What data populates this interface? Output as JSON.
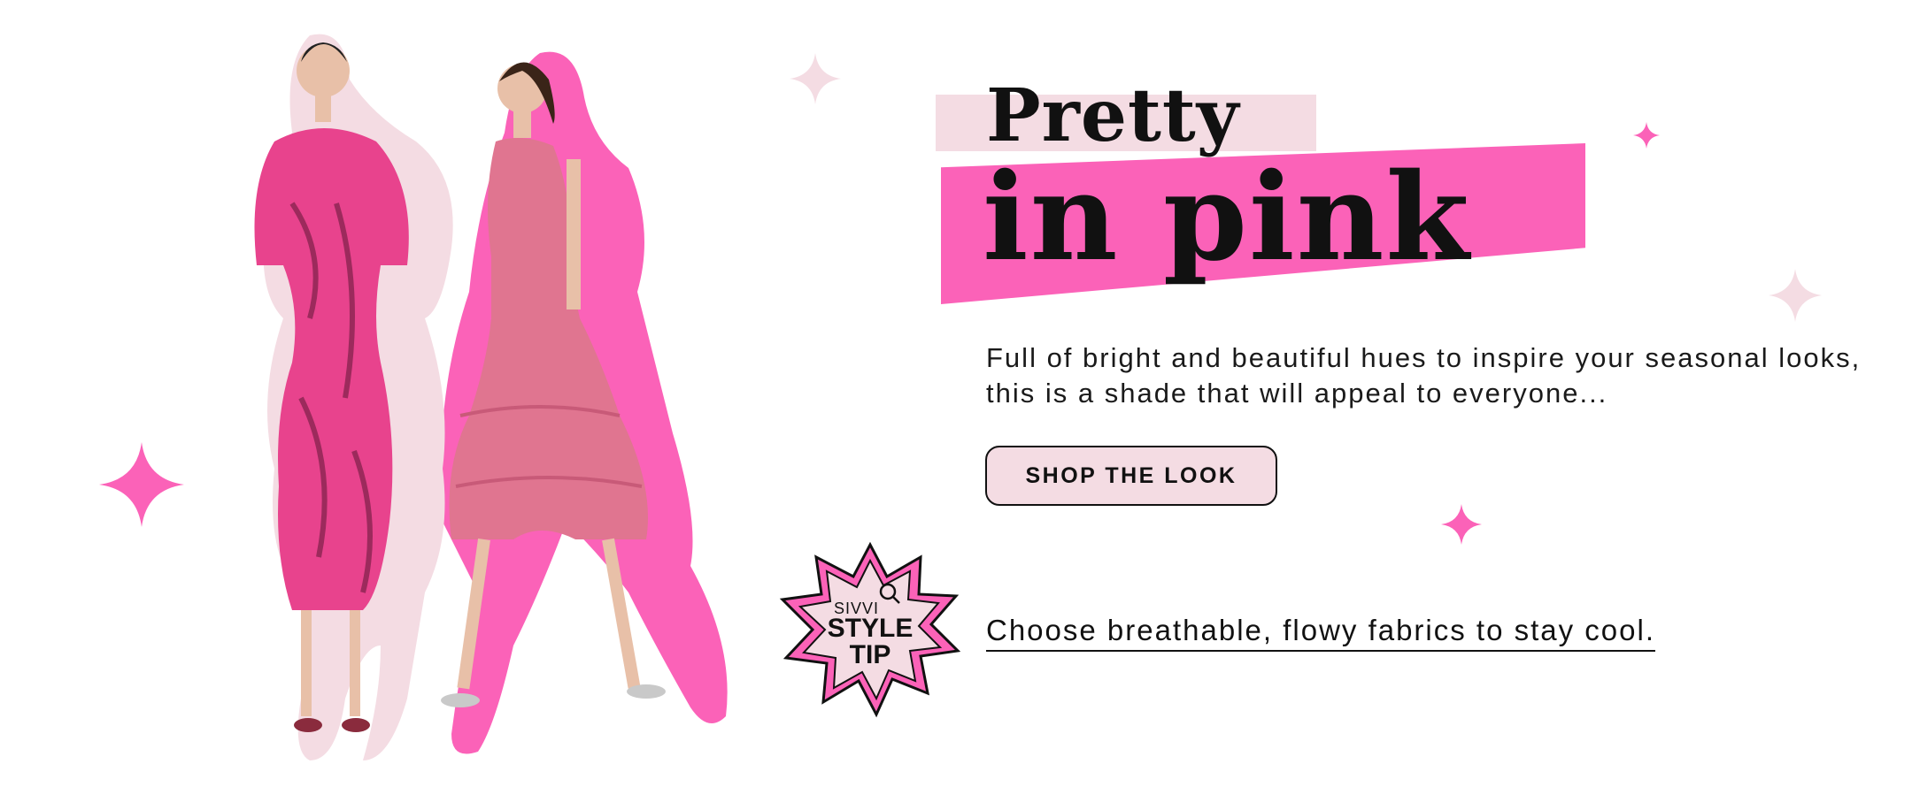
{
  "colors": {
    "accent_pink": "#fb62b8",
    "light_pink": "#f4dce3",
    "text": "#111111",
    "background": "#ffffff"
  },
  "hero": {
    "title_line1": "Pretty",
    "title_line2": "in pink",
    "description": "Full of bright and beautiful hues to inspire your seasonal looks, this is a shade that will appeal to everyone...",
    "cta_label": "SHOP THE LOOK"
  },
  "style_tip": {
    "badge_brand": "SIVVI",
    "badge_line1": "STYLE",
    "badge_line2": "TIP",
    "badge_icon": "magnifier-icon",
    "tip_text": "Choose breathable, flowy fabrics to stay cool."
  },
  "imagery": {
    "models_photo": "two-models-in-pink-dresses",
    "decorations": [
      "sparkle-icon"
    ]
  }
}
